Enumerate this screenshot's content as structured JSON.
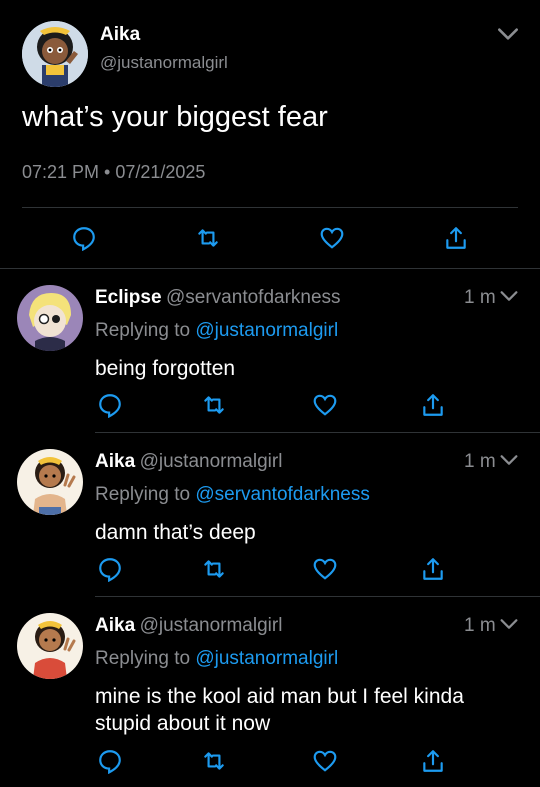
{
  "main_tweet": {
    "name": "Aika",
    "handle": "@justanormalgirl",
    "text": "what’s your biggest fear",
    "timestamp": "07:21 PM • 07/21/2025"
  },
  "replies": [
    {
      "name": "Eclipse",
      "handle": "@servantofdarkness",
      "time": "1 m",
      "replying_label": "Replying to",
      "replying_to": "@justanormalgirl",
      "text": "being forgotten"
    },
    {
      "name": "Aika",
      "handle": "@justanormalgirl",
      "time": "1 m",
      "replying_label": "Replying to",
      "replying_to": "@servantofdarkness",
      "text": "damn that’s deep"
    },
    {
      "name": "Aika",
      "handle": "@justanormalgirl",
      "time": "1 m",
      "replying_label": "Replying to",
      "replying_to": "@justanormalgirl",
      "text": "mine is the kool aid man but I feel kinda stupid about it now"
    }
  ],
  "colors": {
    "background": "#000000",
    "muted": "#8b8d91",
    "link": "#1d9bf0",
    "icon": "#1d9bf0"
  },
  "icons": [
    "comment-icon",
    "retweet-icon",
    "like-icon",
    "share-icon",
    "chevron-down-icon"
  ]
}
